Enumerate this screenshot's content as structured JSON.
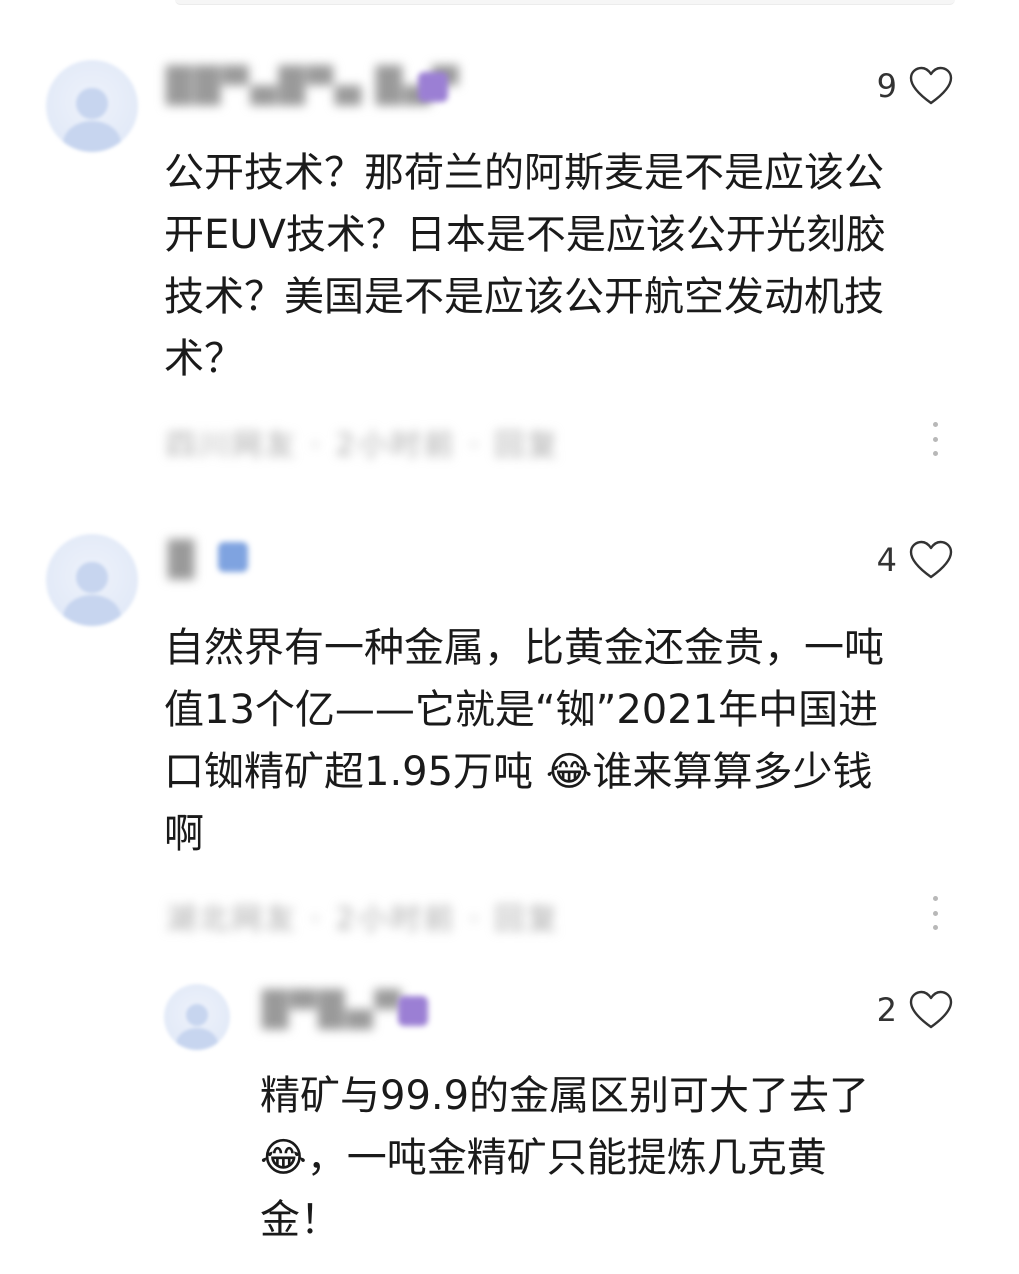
{
  "comments": [
    {
      "username": "██▀▄█▀▄ █▄▀",
      "likes": "9",
      "content": "公开技术？那荷兰的阿斯麦是不是应该公开EUV技术？日本是不是应该公开光刻胶技术？美国是不是应该公开航空发动机技术？",
      "meta": "四川网友 · 2小时前 · 回复"
    },
    {
      "username": "█",
      "likes": "4",
      "content": "自然界有一种金属，比黄金还金贵，一吨值13个亿——它就是“铷”2021年中国进口铷精矿超1.95万吨 😂谁来算算多少钱啊",
      "meta": "湖北网友 · 2小时前 · 回复"
    },
    {
      "username": "█▀█▄▀",
      "likes": "2",
      "content": "精矿与99.9的金属区别可大了去了😂，一吨金精矿只能提炼几克黄金！"
    }
  ],
  "colors": {
    "badge_purple": "#9b7fd4",
    "badge_blue": "#7fa3e0",
    "text": "#1a1a1a",
    "muted": "#a8a8a8"
  },
  "icons": [
    "heart-icon",
    "more-icon",
    "avatar-icon"
  ]
}
